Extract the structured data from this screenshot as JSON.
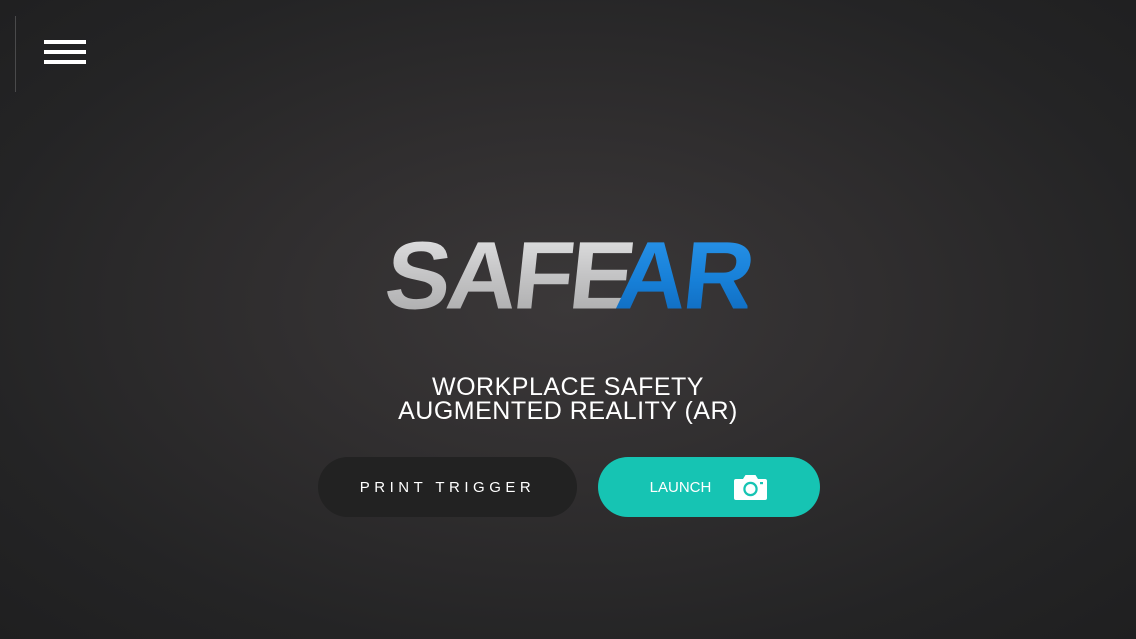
{
  "header": {
    "menu_icon": "hamburger-menu-icon"
  },
  "logo": {
    "part1": "SAFE",
    "part2": "AR",
    "colors": {
      "safe": "#c9c9ca",
      "ar": "#1a7fd6"
    }
  },
  "tagline": {
    "line1": "WORKPLACE SAFETY",
    "line2": "AUGMENTED REALITY (AR)"
  },
  "buttons": {
    "print_trigger": "PRINT TRIGGER",
    "launch": "LAUNCH",
    "launch_icon": "camera-icon"
  },
  "colors": {
    "accent": "#16c4b3",
    "dark_button": "#222222",
    "background": "#2e2c2d"
  }
}
